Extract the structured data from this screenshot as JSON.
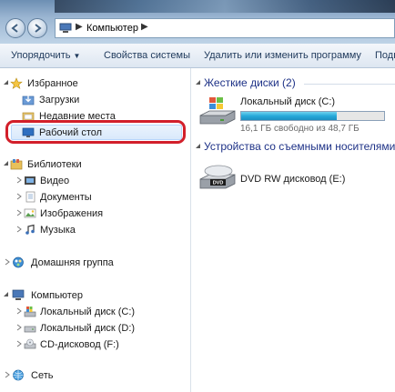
{
  "address": {
    "location": "Компьютер"
  },
  "toolbar": {
    "organize": "Упорядочить",
    "properties": "Свойства системы",
    "uninstall": "Удалить или изменить программу",
    "more": "Подк"
  },
  "sidebar": {
    "favorites": {
      "label": "Избранное",
      "items": [
        {
          "label": "Загрузки",
          "icon": "downloads-folder-icon"
        },
        {
          "label": "Недавние места",
          "icon": "recent-places-icon"
        },
        {
          "label": "Рабочий стол",
          "icon": "desktop-icon",
          "selected": true
        }
      ]
    },
    "libraries": {
      "label": "Библиотеки",
      "items": [
        {
          "label": "Видео"
        },
        {
          "label": "Документы"
        },
        {
          "label": "Изображения"
        },
        {
          "label": "Музыка"
        }
      ]
    },
    "homegroup": {
      "label": "Домашняя группа"
    },
    "computer": {
      "label": "Компьютер",
      "items": [
        {
          "label": "Локальный диск (C:)"
        },
        {
          "label": "Локальный диск (D:)"
        },
        {
          "label": "CD-дисковод (F:)"
        }
      ]
    },
    "network": {
      "label": "Сеть"
    }
  },
  "content": {
    "hard_drives": {
      "title": "Жесткие диски (2)",
      "drives": [
        {
          "name": "Локальный диск (C:)",
          "free_text": "16,1 ГБ свободно из 48,7 ГБ",
          "used_fraction": 0.67
        }
      ]
    },
    "removable": {
      "title": "Устройства со съемными носителями",
      "drives": [
        {
          "name": "DVD RW дисковод (E:)",
          "icon": "dvd-drive-icon"
        }
      ]
    }
  },
  "colors": {
    "highlight": "#d21f2a",
    "group_title": "#1e3287",
    "bar_fill": "#27a9d9"
  }
}
